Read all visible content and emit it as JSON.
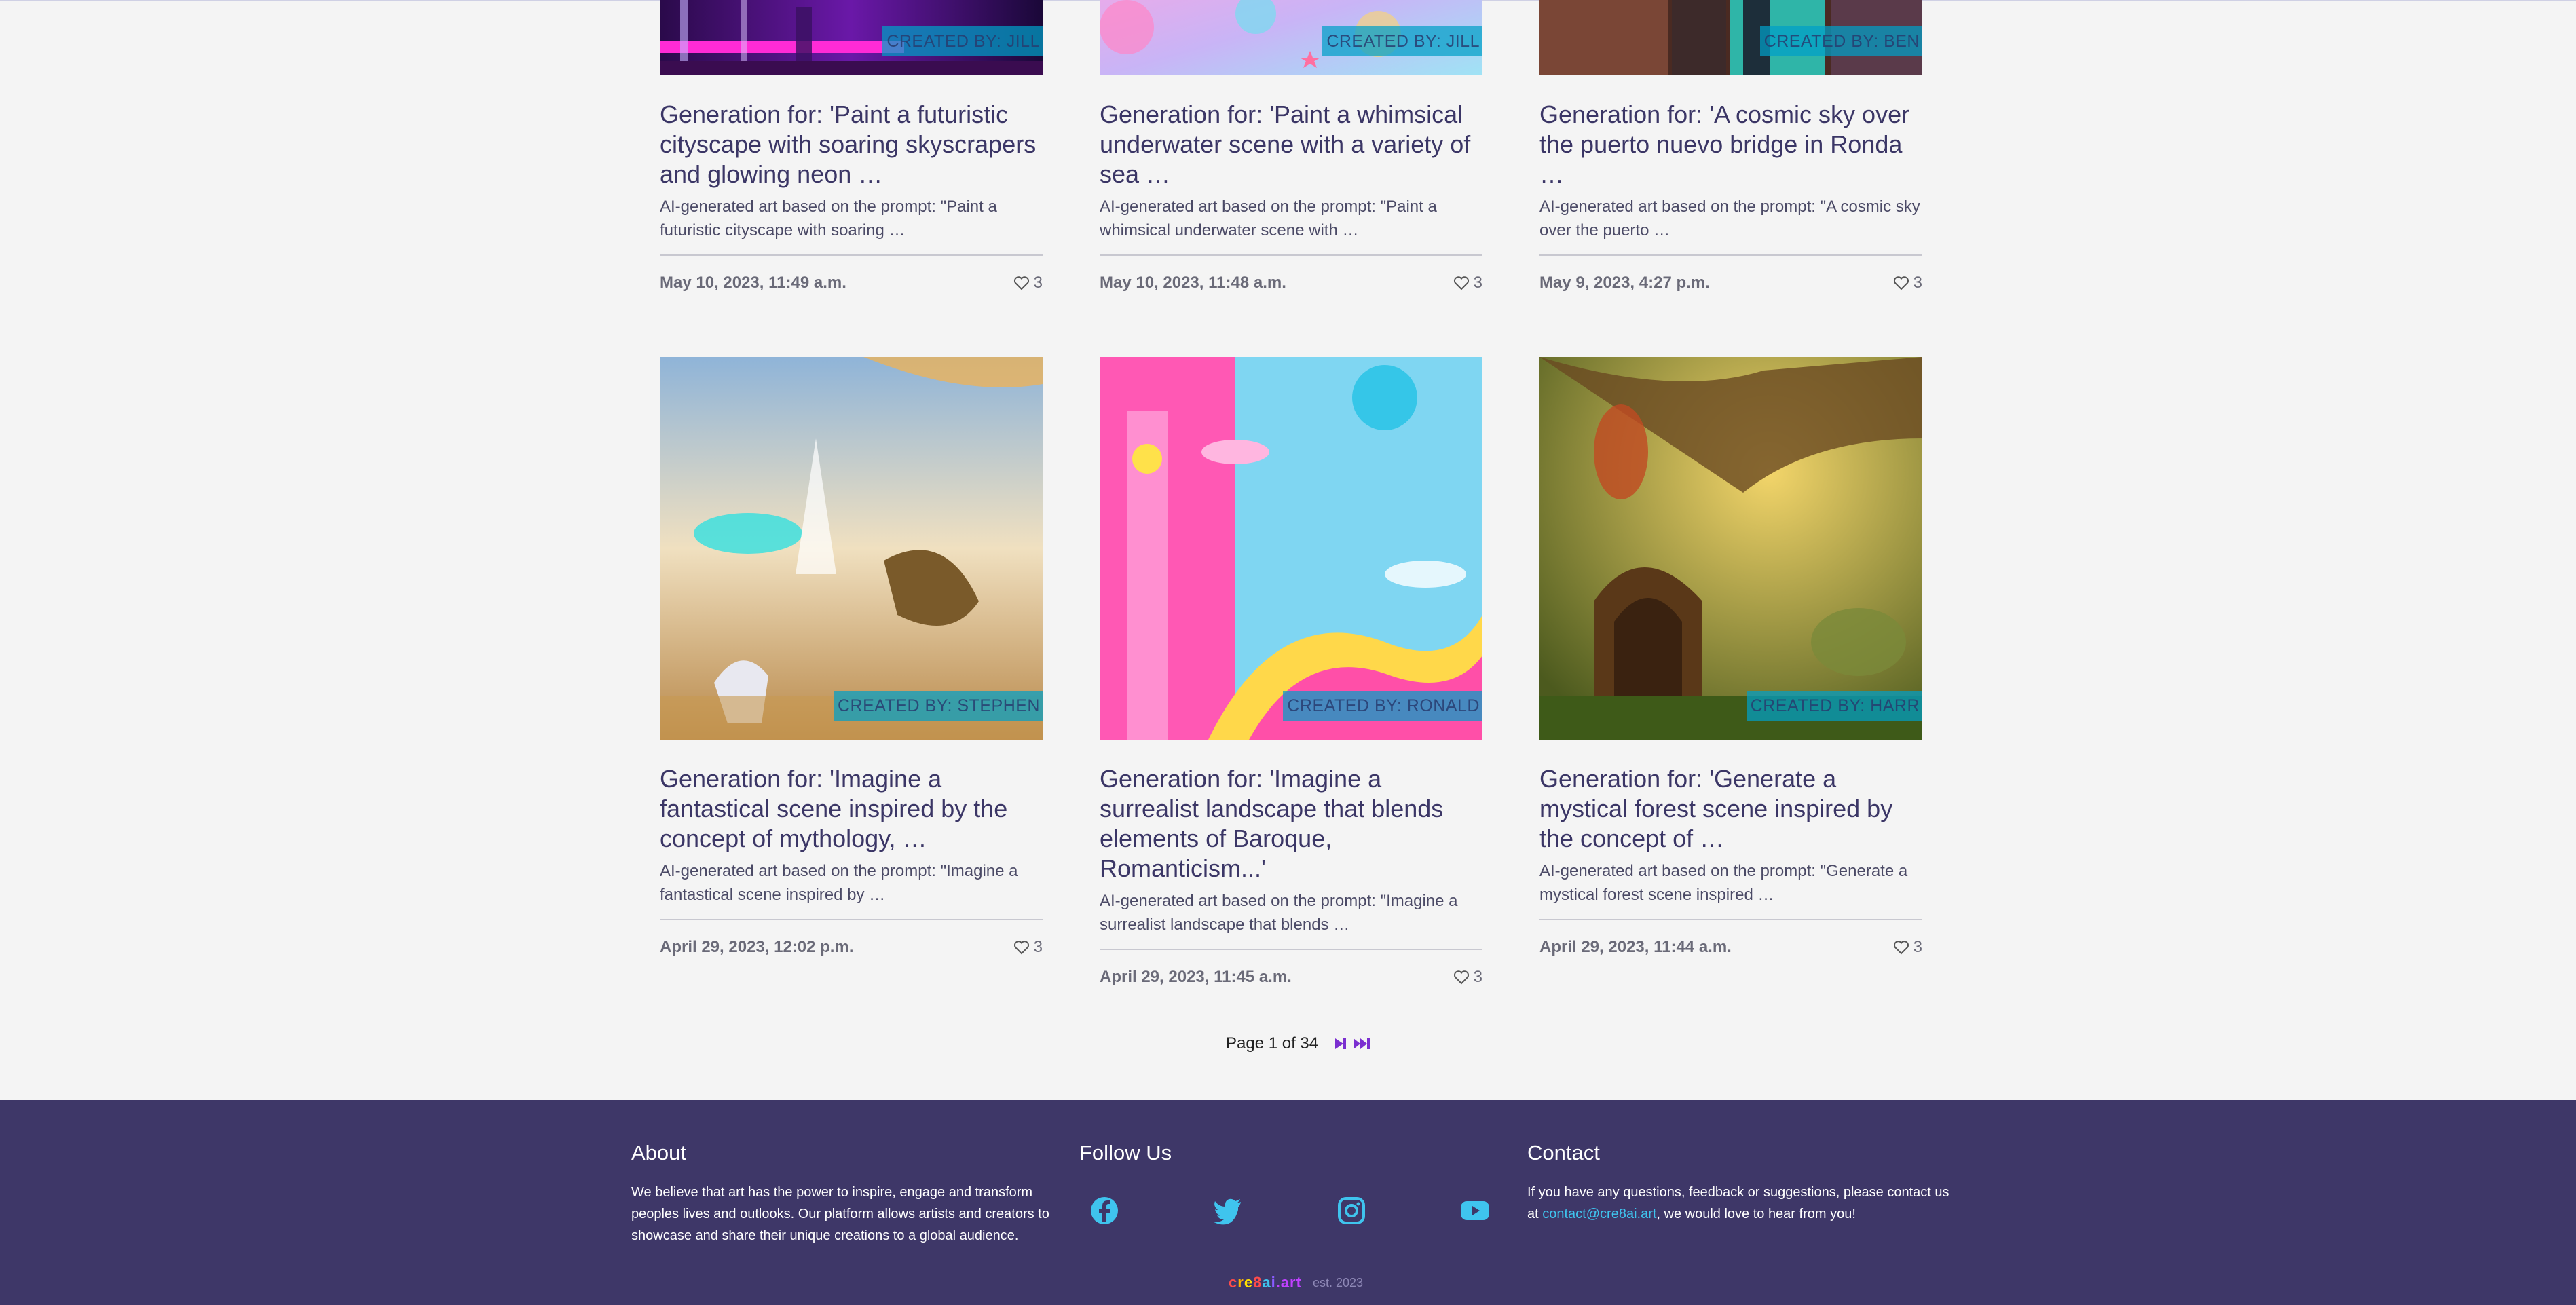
{
  "cards": [
    {
      "creator": "CREATED BY: JILL",
      "title": "Generation for: 'Paint a futuristic cityscape with soaring skyscrapers and glowing neon …",
      "description": "AI-generated art based on the prompt: \"Paint a futuristic cityscape with soaring …",
      "date": "May 10, 2023, 11:49 a.m.",
      "likes": "3"
    },
    {
      "creator": "CREATED BY: JILL",
      "title": "Generation for: 'Paint a whimsical underwater scene with a variety of sea …",
      "description": "AI-generated art based on the prompt: \"Paint a whimsical underwater scene with …",
      "date": "May 10, 2023, 11:48 a.m.",
      "likes": "3"
    },
    {
      "creator": "CREATED BY: BEN",
      "title": "Generation for: 'A cosmic sky over the puerto nuevo bridge in Ronda …",
      "description": "AI-generated art based on the prompt: \"A cosmic sky over the puerto …",
      "date": "May 9, 2023, 4:27 p.m.",
      "likes": "3"
    },
    {
      "creator": "CREATED BY: STEPHEN",
      "title": "Generation for: 'Imagine a fantastical scene inspired by the concept of mythology, …",
      "description": "AI-generated art based on the prompt: \"Imagine a fantastical scene inspired by …",
      "date": "April 29, 2023, 12:02 p.m.",
      "likes": "3"
    },
    {
      "creator": "CREATED BY: RONALD",
      "title": "Generation for: 'Imagine a surrealist landscape that blends elements of Baroque, Romanticism...'",
      "description": "AI-generated art based on the prompt: \"Imagine a surrealist landscape that blends …",
      "date": "April 29, 2023, 11:45 a.m.",
      "likes": "3"
    },
    {
      "creator": "CREATED BY: HARR",
      "title": "Generation for: 'Generate a mystical forest scene inspired by the concept of …",
      "description": "AI-generated art based on the prompt: \"Generate a mystical forest scene inspired …",
      "date": "April 29, 2023, 11:44 a.m.",
      "likes": "3"
    }
  ],
  "pagination": {
    "label": "Page 1 of 34",
    "next_icon": "next-page-icon",
    "last_icon": "last-page-icon"
  },
  "footer": {
    "about": {
      "heading": "About",
      "text": "We believe that art has the power to inspire, engage and transform peoples lives and outlooks. Our platform allows artists and creators to showcase and share their unique creations to a global audience."
    },
    "follow": {
      "heading": "Follow Us",
      "icons": [
        "facebook-icon",
        "twitter-icon",
        "instagram-icon",
        "youtube-icon"
      ]
    },
    "contact": {
      "heading": "Contact",
      "text_before": "If you have any questions, feedback or suggestions, please contact us at ",
      "email": "contact@cre8ai.art",
      "text_after": ", we would love to hear from you!"
    },
    "logo": "cre8ai.art",
    "est": "est. 2023"
  },
  "colors": {
    "footer_bg": "#3e3768",
    "accent": "#3fc4ee",
    "pager_icon": "#7b2fd0",
    "heading_text": "#3b3666"
  }
}
